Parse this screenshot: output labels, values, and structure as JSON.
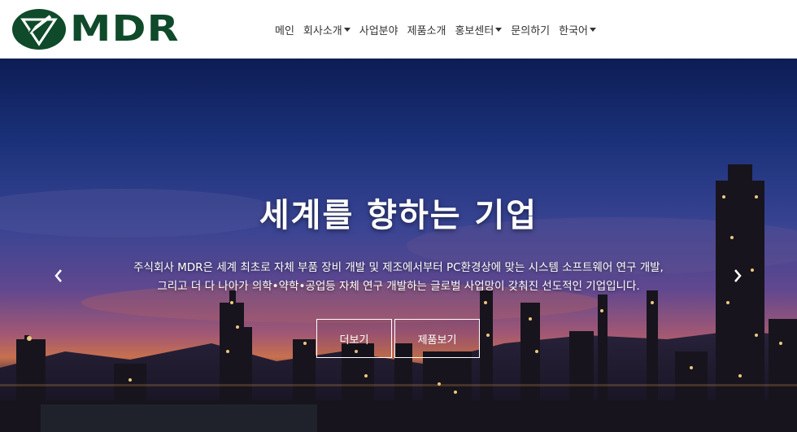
{
  "brand": {
    "name": "MDR",
    "color": "#0f4a2a",
    "icon": "mdr-logo-icon"
  },
  "nav": {
    "items": [
      {
        "label": "메인",
        "dropdown": false
      },
      {
        "label": "회사소개",
        "dropdown": true
      },
      {
        "label": "사업분야",
        "dropdown": false
      },
      {
        "label": "제품소개",
        "dropdown": false
      },
      {
        "label": "홍보센터",
        "dropdown": true
      },
      {
        "label": "문의하기",
        "dropdown": false
      },
      {
        "label": "한국어",
        "dropdown": true
      }
    ]
  },
  "hero": {
    "title": "세계를 향하는 기업",
    "desc_line1": "주식회사 MDR은 세계 최초로 자체 부품 장비 개발 및 제조에서부터 PC환경상에 맞는 시스템 소프트웨어 연구 개발,",
    "desc_line2": "그리고 더 다 나아가 의학•약학•공업등 자체 연구 개발하는 글로벌 사업망이 갖춰진 선도적인 기업입니다.",
    "button_more": "더보기",
    "button_products": "제품보기",
    "prev_icon": "chevron-left-icon",
    "next_icon": "chevron-right-icon"
  }
}
